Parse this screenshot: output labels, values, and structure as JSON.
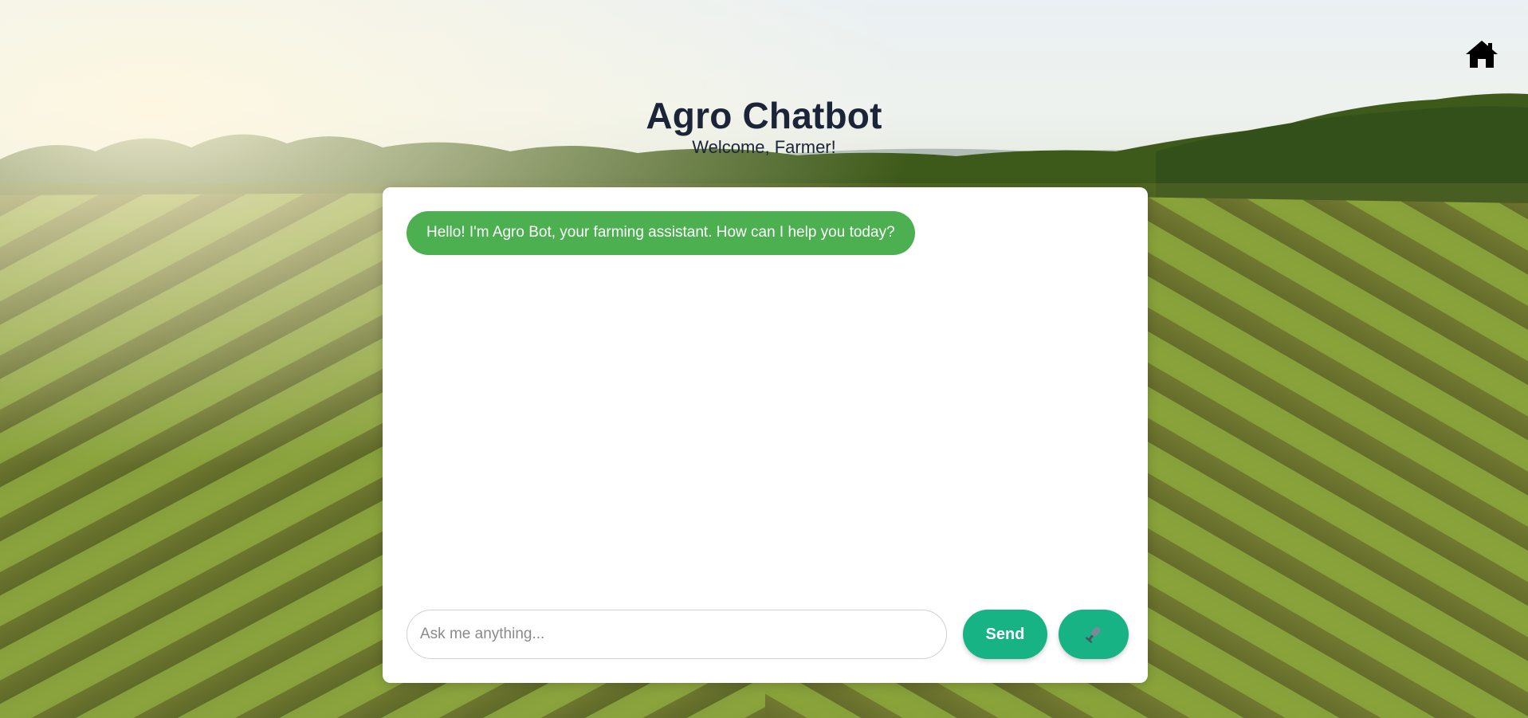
{
  "header": {
    "title": "Agro Chatbot",
    "subtitle": "Welcome, Farmer!"
  },
  "nav": {
    "home_icon": "home-icon"
  },
  "chat": {
    "messages": [
      {
        "sender": "bot",
        "text": "Hello! I'm Agro Bot, your farming assistant. How can I help you today?"
      }
    ],
    "input": {
      "placeholder": "Ask me anything...",
      "value": ""
    },
    "send_label": "Send",
    "mic_icon": "microphone-icon"
  },
  "colors": {
    "bot_bubble": "#4caf50",
    "button_accent": "#17b384",
    "title_text": "#1b2438",
    "card_bg": "#ffffff"
  }
}
